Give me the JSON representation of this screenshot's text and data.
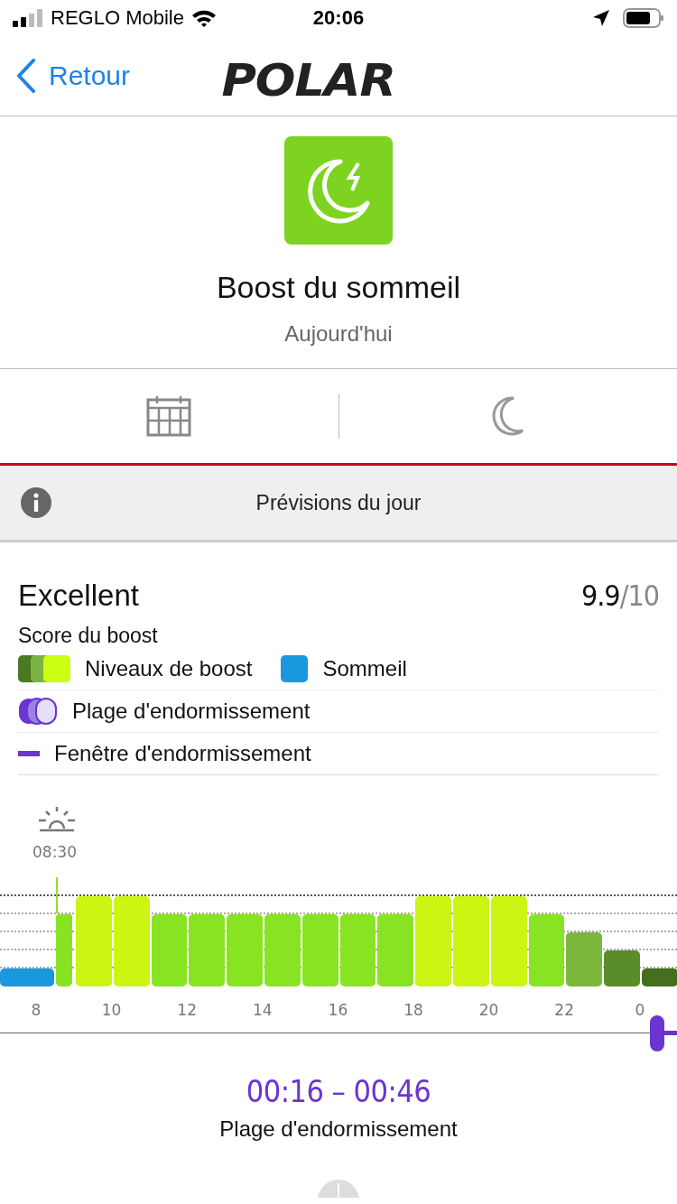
{
  "status_bar": {
    "carrier": "REGLO Mobile",
    "time": "20:06"
  },
  "nav": {
    "back": "Retour",
    "logo": "POLAR"
  },
  "header": {
    "title": "Boost du sommeil",
    "subtitle": "Aujourd'hui"
  },
  "info_bar": {
    "title": "Prévisions du jour"
  },
  "summary": {
    "rating": "Excellent",
    "score": "9.9",
    "max": "/10",
    "label": "Score du boost"
  },
  "legend": [
    {
      "kind": "boost",
      "label": "Niveaux de boost"
    },
    {
      "kind": "sleep",
      "label": "Sommeil"
    },
    {
      "kind": "range",
      "label": "Plage d'endormissement"
    },
    {
      "kind": "window",
      "label": "Fenêtre d'endormissement"
    }
  ],
  "chart": {
    "marker_time": "08:30",
    "hours": [
      "8",
      "10",
      "12",
      "14",
      "16",
      "18",
      "20",
      "22",
      "0"
    ],
    "bars": [
      {
        "kind": "sleep"
      },
      {
        "kind": "high"
      },
      {
        "kind": "peak"
      },
      {
        "kind": "peak"
      },
      {
        "kind": "high"
      },
      {
        "kind": "high"
      },
      {
        "kind": "high"
      },
      {
        "kind": "high"
      },
      {
        "kind": "high"
      },
      {
        "kind": "high"
      },
      {
        "kind": "high"
      },
      {
        "kind": "peak"
      },
      {
        "kind": "peak"
      },
      {
        "kind": "peak"
      },
      {
        "kind": "high"
      },
      {
        "kind": "moderate"
      },
      {
        "kind": "low"
      },
      {
        "kind": "minimal"
      }
    ]
  },
  "sleep_range": {
    "time": "00:16 – 00:46",
    "label": "Plage d'endormissement"
  }
}
